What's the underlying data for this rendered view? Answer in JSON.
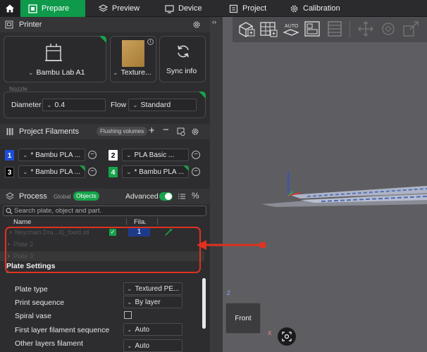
{
  "tabs": {
    "home_icon": "home-icon",
    "prepare": "Prepare",
    "preview": "Preview",
    "device": "Device",
    "project": "Project",
    "calibration": "Calibration"
  },
  "printer": {
    "section_title": "Printer",
    "printer_name": "Bambu Lab A1",
    "plate_name": "Texture...",
    "sync_label": "Sync info",
    "nozzle_label": "Nozzle",
    "diameter_label": "Diameter",
    "diameter_value": "0.4",
    "flow_label": "Flow",
    "flow_value": "Standard"
  },
  "filaments": {
    "section_title": "Project Filaments",
    "flushing_label": "Flushing volumes",
    "items": [
      {
        "num": "1",
        "name": "* Bambu PLA ...",
        "color": "#1d4ed8",
        "text_color": "#ffffff"
      },
      {
        "num": "2",
        "name": "PLA Basic ...",
        "color": "#ffffff",
        "text_color": "#000000"
      },
      {
        "num": "3",
        "name": "* Bambu PLA ...",
        "color": "#000000",
        "text_color": "#ffffff"
      },
      {
        "num": "4",
        "name": "* Bambu PLA ...",
        "color": "#16a34a",
        "text_color": "#ffffff"
      }
    ]
  },
  "process": {
    "section_title": "Process",
    "global_label": "Global",
    "objects_label": "Objects",
    "advanced_label": "Advanced",
    "search_placeholder": "Search plate, object and part.",
    "col_name": "Name",
    "col_fila": "Fila.",
    "rows": [
      {
        "name": "Neychain Dra...4)_fixed.stl",
        "fila": "1"
      },
      {
        "name": "Plate 2"
      },
      {
        "name": "Plate 3"
      }
    ],
    "plate_settings_label": "Plate Settings"
  },
  "plate_settings": [
    {
      "label": "Plate type",
      "value": "Textured PE..."
    },
    {
      "label": "Print sequence",
      "value": "By layer"
    },
    {
      "label": "Spiral vase",
      "value": ""
    },
    {
      "label": "First layer filament sequence",
      "value": "Auto"
    },
    {
      "label": "Other layers filament",
      "value": "Auto"
    }
  ],
  "viewport": {
    "view_cube_label": "Front",
    "axis_z": "Z",
    "axis_x": "X"
  },
  "colors": {
    "accent": "#0e9a4a",
    "highlight_box": "#e0321f",
    "annotation_arrow": "#e0321f"
  }
}
